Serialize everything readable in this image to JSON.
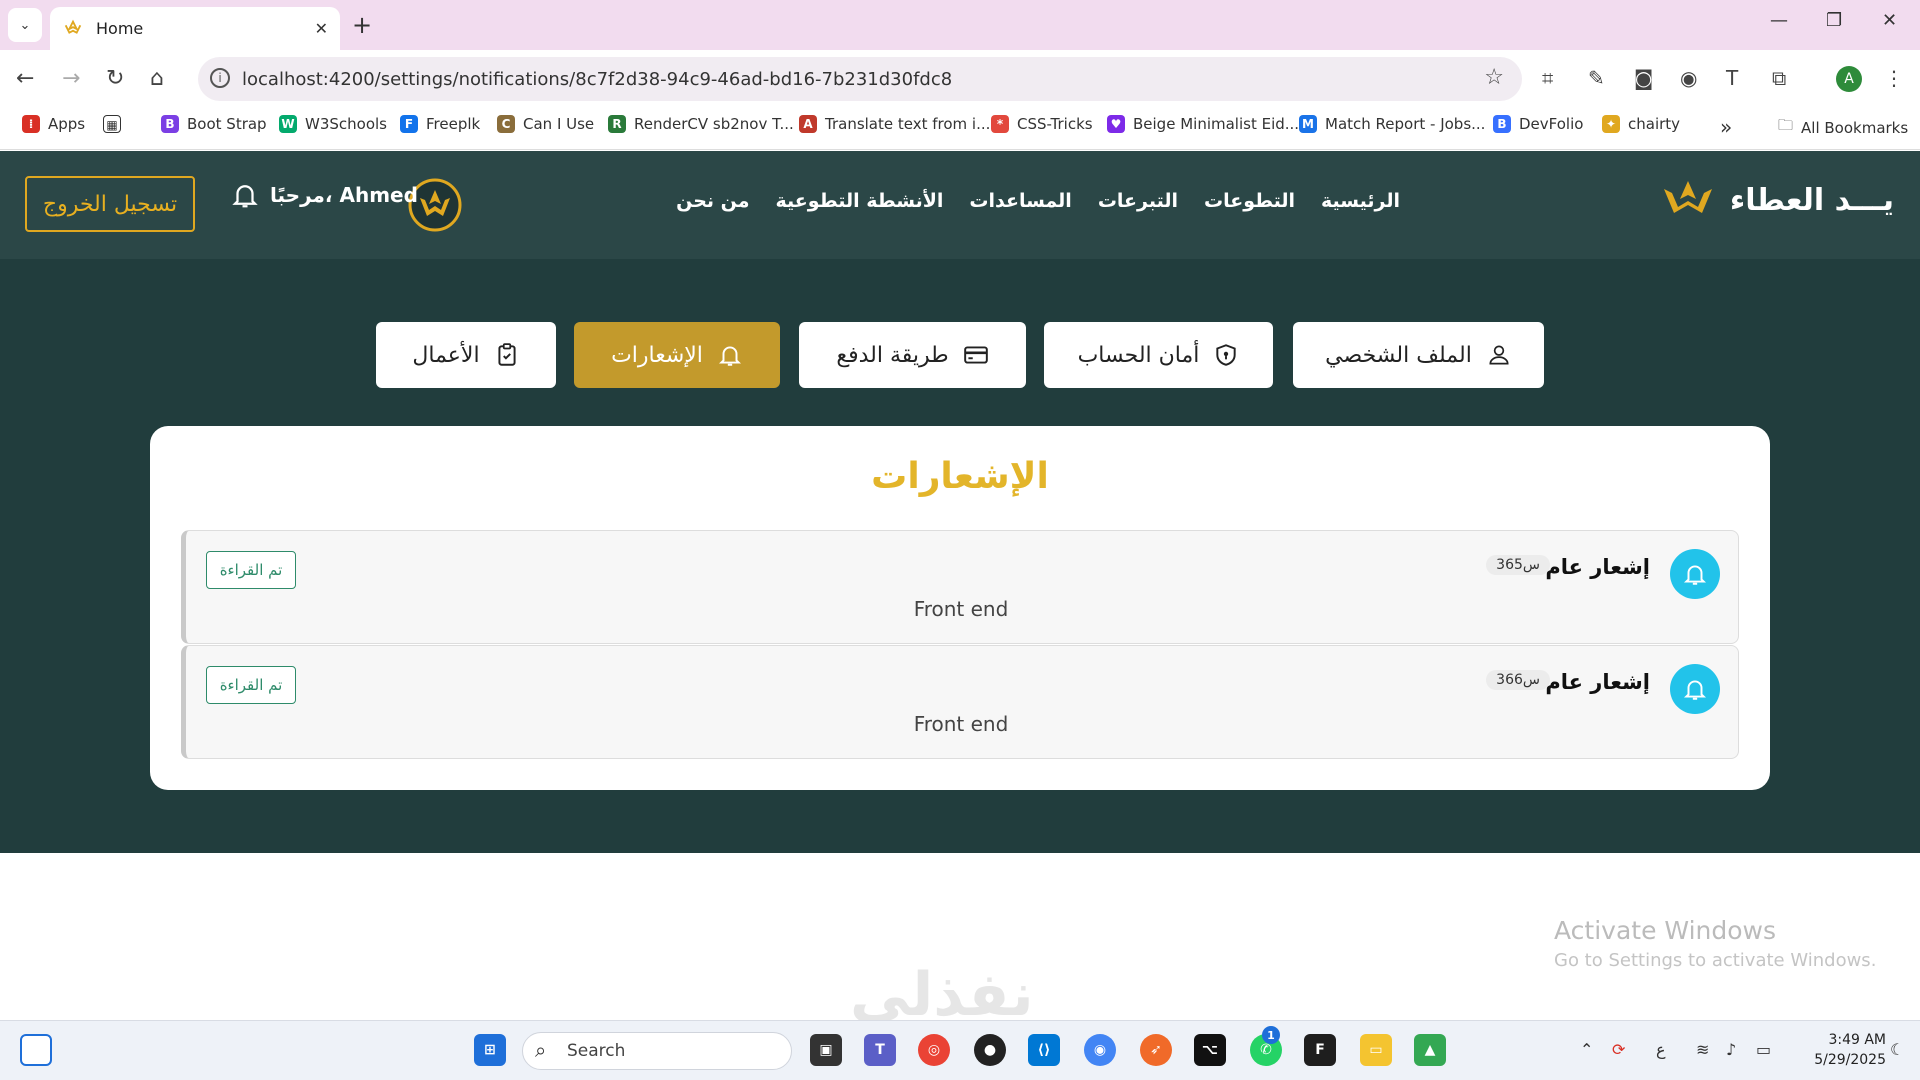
{
  "browser": {
    "tab_title": "Home",
    "url": "localhost:4200/settings/notifications/8c7f2d38-94c9-46ad-bd16-7b231d30fdc8",
    "bookmarks": [
      {
        "label": "Apps",
        "icon": "apps-grid-icon",
        "color": "#d93025"
      },
      {
        "label": "",
        "icon": "tab-groups-icon",
        "color": "#333333"
      },
      {
        "label": "Boot Strap",
        "icon": "bootstrap-icon",
        "color": "#7b3fe4"
      },
      {
        "label": "W3Schools",
        "icon": "w3schools-icon",
        "color": "#04aa6d"
      },
      {
        "label": "Freeplk",
        "icon": "freepik-icon",
        "color": "#1273eb"
      },
      {
        "label": "Can I Use",
        "icon": "caniuse-icon",
        "color": "#8a6d3b"
      },
      {
        "label": "RenderCV sb2nov T...",
        "icon": "rendercv-icon",
        "color": "#2a7a3a"
      },
      {
        "label": "Translate text from i...",
        "icon": "translate-icon",
        "color": "#c0392b"
      },
      {
        "label": "CSS-Tricks",
        "icon": "csstricks-icon",
        "color": "#e2483d"
      },
      {
        "label": "Beige Minimalist Eid...",
        "icon": "canva-icon",
        "color": "#7d2ae8"
      },
      {
        "label": "Match Report - Jobs...",
        "icon": "match-report-icon",
        "color": "#1a73e8"
      },
      {
        "label": "DevFolio",
        "icon": "devfolio-icon",
        "color": "#3770ff"
      },
      {
        "label": "chairty",
        "icon": "charity-icon",
        "color": "#e0a820"
      }
    ],
    "more_bookmarks": "»",
    "all_bookmarks": "All Bookmarks",
    "profile_initial": "A"
  },
  "site": {
    "brand": "يـــد العطاء",
    "nav": [
      "الرئيسية",
      "التطوعات",
      "التبرعات",
      "المساعدات",
      "الأنشطة التطوعية",
      "من نحن"
    ],
    "greeting": "مرحبًا، Ahmed",
    "logout": "تسجيل الخروج",
    "colors": {
      "header": "#2b4747",
      "main": "#213d3d",
      "accent": "#c39a2c",
      "title": "#e3b52a",
      "bell": "#22c3ea"
    }
  },
  "settings_tabs": [
    {
      "label": "الملف الشخصي",
      "icon": "user-icon",
      "active": false
    },
    {
      "label": "أمان الحساب",
      "icon": "shield-icon",
      "active": false
    },
    {
      "label": "طريقة الدفع",
      "icon": "credit-card-icon",
      "active": false
    },
    {
      "label": "الإشعارات",
      "icon": "bell-icon",
      "active": true
    },
    {
      "label": "الأعمال",
      "icon": "clipboard-icon",
      "active": false
    }
  ],
  "notifications": {
    "title": "الإشعارات",
    "items": [
      {
        "title": "إشعار عام",
        "time": "365س",
        "body": "Front end",
        "action": "تم القراءة"
      },
      {
        "title": "إشعار عام",
        "time": "366س",
        "body": "Front end",
        "action": "تم القراءة"
      }
    ]
  },
  "watermark": {
    "line1": "Activate Windows",
    "line2": "Go to Settings to activate Windows."
  },
  "footer_logo": "نفذلي",
  "taskbar": {
    "search": "Search",
    "time": "3:49 AM",
    "date": "5/29/2025",
    "lang": "ع",
    "whatsapp_badge": "1"
  }
}
